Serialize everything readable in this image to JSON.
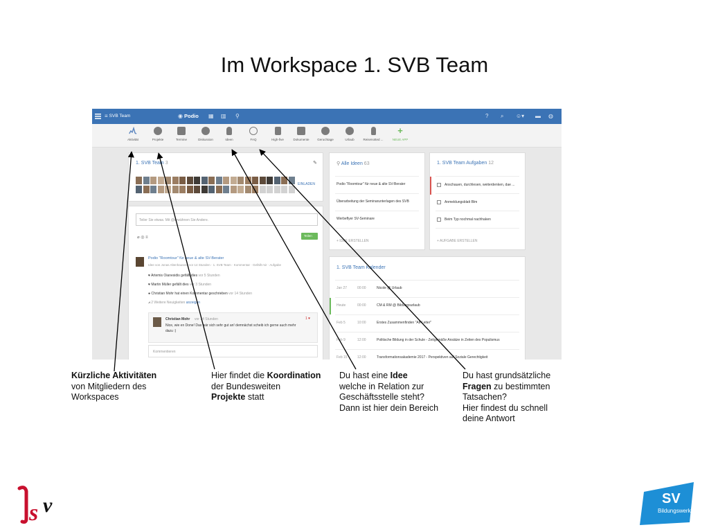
{
  "slide": {
    "title": "Im Workspace 1. SVB Team"
  },
  "topbar": {
    "menu_icon": "menu-icon",
    "workspace": "SVB Team",
    "brand": "Podio"
  },
  "apps": [
    {
      "label": "Aktivität",
      "icon": "activity-icon"
    },
    {
      "label": "Projekte",
      "icon": "projects-icon"
    },
    {
      "label": "Termine",
      "icon": "calendar-icon"
    },
    {
      "label": "Diskussion",
      "icon": "discussion-icon"
    },
    {
      "label": "Ideen",
      "icon": "idea-icon"
    },
    {
      "label": "FAQ",
      "icon": "faq-icon"
    },
    {
      "label": "High-five",
      "icon": "high-five-icon"
    },
    {
      "label": "Dokumente",
      "icon": "documents-icon"
    },
    {
      "label": "Geruchtage",
      "icon": "geruchtage-icon"
    },
    {
      "label": "Urlaub",
      "icon": "vacation-icon"
    },
    {
      "label": "Reisenotted ...",
      "icon": "travel-icon"
    },
    {
      "label": "NEUE APP",
      "icon": "plus-icon"
    }
  ],
  "team_panel": {
    "title": "1. SVB Team",
    "count": "3",
    "invite": "EINLADEN"
  },
  "activity": {
    "share_placeholder": "Teiler Sie etwas. Mit @erwähnen Sie Andere.",
    "share_button": "Teilen",
    "post_title": "Podio \"Roomtour\" für neue & alte SV-Berater",
    "post_meta": "Idee von Jonas Altenhausen, vor 14 Stunden · 1. SVB Team · Kommentar · Gefällt mir · Aufgabe",
    "events": [
      {
        "icon": "heart-icon",
        "text": "Artemis Oianesidis gefällt dies",
        "time": "vor 5 Stunden"
      },
      {
        "icon": "heart-icon",
        "text": "Martin Müller gefällt dies",
        "time": "vor 3 Stunden"
      },
      {
        "icon": "comment-icon",
        "text": "Christian Mohr hat einen Kommentar geschrieben",
        "time": "vor 14 Stunden"
      },
      {
        "icon": "views-icon",
        "text": "2 Weitere Neuigkeiten",
        "link": "anzeigen"
      }
    ],
    "comment_author": "Christian Mohr",
    "comment_time": "vor 14 Stunden",
    "comment_text_1": "Nice, wie en Done! Das wär sich sehr gut an! demnächst scheib ich gerne auch mehr",
    "comment_text_2": "dazu :)",
    "comment_likes": "1",
    "comment_input_placeholder": "Kommentieren"
  },
  "ideas_panel": {
    "title": "Alle Ideen",
    "count": "63",
    "items": [
      "Podio \"Roomtour\" für neue & alte SV-Berater",
      "Überarbeitung der Seminarunterlagen des SVB",
      "Werbeflyer SV-Seminare"
    ],
    "create": "+ IDEE ERSTELLEN"
  },
  "tasks_panel": {
    "title": "1. SVB Team Aufgaben",
    "count": "12",
    "items": [
      "Anschauen, durchlesen, weiterdenken, dae ...",
      "Anmeldungsblatt Blm",
      "Beim Typ nochmal nachhaken"
    ],
    "create": "+ AUFGABE ERSTELLEN"
  },
  "calendar_panel": {
    "title": "1. SVB Team Kalender",
    "events": [
      {
        "date": "Jan 27",
        "time": "00:00",
        "title": "Nicole @ Urlaub"
      },
      {
        "date": "Heute",
        "time": "00:00",
        "title": "CM & RM @ Bildungsurlaub"
      },
      {
        "date": "Feb 5",
        "time": "10:00",
        "title": "Erstes Zusammenfinden \"Alt-Leiter\""
      },
      {
        "date": "Feb 9",
        "time": "12:00",
        "title": "Politische Bildung in der Schule - Zeitgemäße Ansätze in Zeiten des Populismus"
      },
      {
        "date": "Feb 15",
        "time": "12:00",
        "title": "Transformationsakademie 2017 - Perspektiven auf Soziale Gerechtigkeit"
      }
    ]
  },
  "captions": {
    "c1_bold": "Kürzliche Aktivitäten",
    "c1_rest": "von Mitgliedern des Workspaces",
    "c2_pre": "Hier findet die ",
    "c2_bold1": "Koordination",
    "c2_mid": "der Bundesweiten",
    "c2_bold2": "Projekte",
    "c2_post": " statt",
    "c3_pre": "Du hast eine ",
    "c3_bold": "Idee",
    "c3_l2": "welche in Relation zur",
    "c3_l3": "Geschäftsstelle steht?",
    "c3_l4": "Dann ist hier dein Bereich",
    "c4_l1": "Du hast grundsätzliche",
    "c4_bold": "Fragen",
    "c4_l2_post": " zu bestimmten",
    "c4_l3": "Tatsachen?",
    "c4_l4": "Hier findest du schnell",
    "c4_l5": "deine Antwort"
  },
  "logos": {
    "left": "ISV",
    "right_top": "SV",
    "right_bottom": "Bildungswerk"
  },
  "colors": {
    "topbar": "#3b73b5",
    "accent_green": "#6cba5c",
    "logo_red": "#c8102e",
    "logo_blue": "#1d8fd6"
  }
}
